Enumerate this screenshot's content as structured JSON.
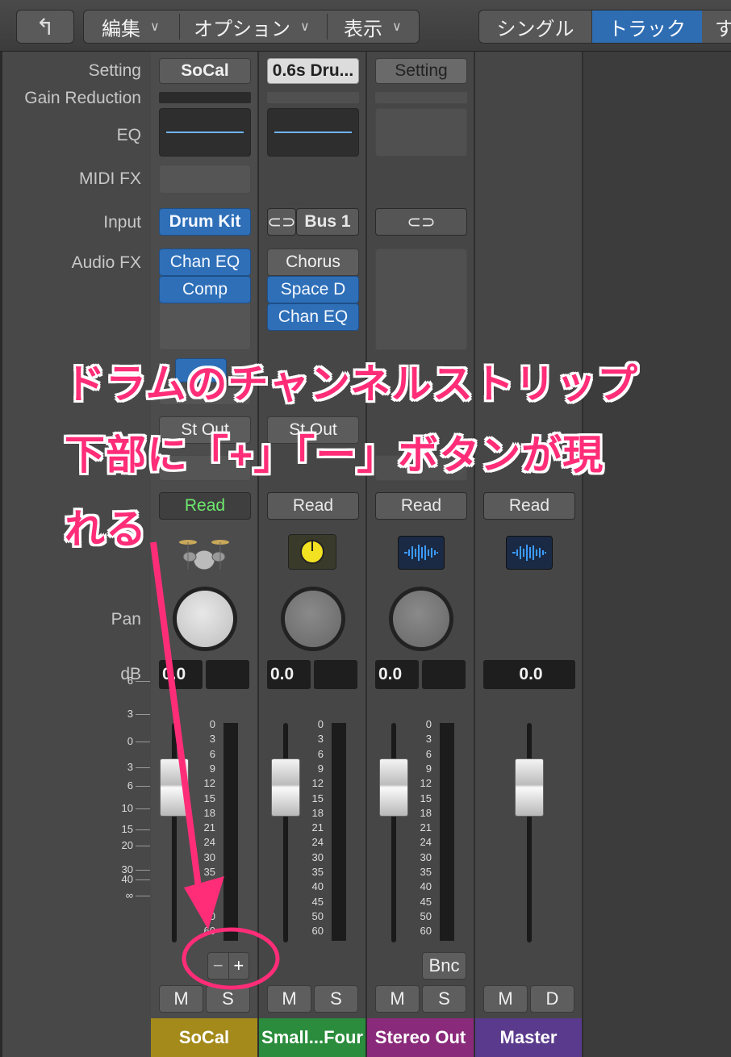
{
  "toolbar": {
    "back_icon": "back-arrow-icon",
    "menus": [
      {
        "label": "編集"
      },
      {
        "label": "オプション"
      },
      {
        "label": "表示"
      }
    ],
    "view_tabs": [
      {
        "label": "シングル",
        "selected": false
      },
      {
        "label": "トラック",
        "selected": true
      },
      {
        "label": "す",
        "selected": false
      }
    ]
  },
  "labels": {
    "setting": "Setting",
    "gain_reduction": "Gain Reduction",
    "eq": "EQ",
    "midi_fx": "MIDI FX",
    "input": "Input",
    "audio_fx": "Audio FX",
    "pan": "Pan",
    "db": "dB"
  },
  "fader_scale": [
    "6",
    "3",
    "0",
    "3",
    "6",
    "10",
    "15",
    "20",
    "30",
    "40",
    "∞"
  ],
  "meter_scale": [
    "0",
    "3",
    "6",
    "9",
    "12",
    "15",
    "18",
    "21",
    "24",
    "30",
    "35",
    "40",
    "45",
    "50",
    "60"
  ],
  "strips": [
    {
      "setting": "SoCal",
      "input": "Drum Kit",
      "audio_fx": [
        "Chan EQ",
        "Comp"
      ],
      "output": "St Out",
      "automation": "Read",
      "db_value": "0.0",
      "mute": "M",
      "solo": "S",
      "name": "SoCal",
      "name_color": "#a38a1a",
      "icon": "drum-kit-icon"
    },
    {
      "setting": "0.6s Dru...",
      "input_prefix": "link-icon",
      "input": "Bus 1",
      "audio_fx": [
        "Chorus",
        "Space D",
        "Chan EQ"
      ],
      "output": "St Out",
      "automation": "Read",
      "db_value": "0.0",
      "mute": "M",
      "solo": "S",
      "name": "Small...Four",
      "name_color": "#2a8c3c",
      "icon": "yellow-knob-icon"
    },
    {
      "setting": "Setting",
      "input": "",
      "output": "",
      "automation": "Read",
      "db_value": "0.0",
      "bounce": "Bnc",
      "mute": "M",
      "solo": "S",
      "name": "Stereo Out",
      "name_color": "#8a2a7a",
      "icon": "waveform-icon"
    },
    {
      "automation": "Read",
      "db_value": "0.0",
      "mute": "M",
      "dim": "D",
      "name": "Master",
      "name_color": "#5a3a8c",
      "icon": "waveform-icon"
    }
  ],
  "annotation": {
    "line1": "ドラムのチャンネルストリップ",
    "line2": "下部に「+」「ー」ボタンが現",
    "line3": "れる",
    "color": "#ff2d78"
  },
  "plus_minus": {
    "minus": "−",
    "plus": "+"
  }
}
